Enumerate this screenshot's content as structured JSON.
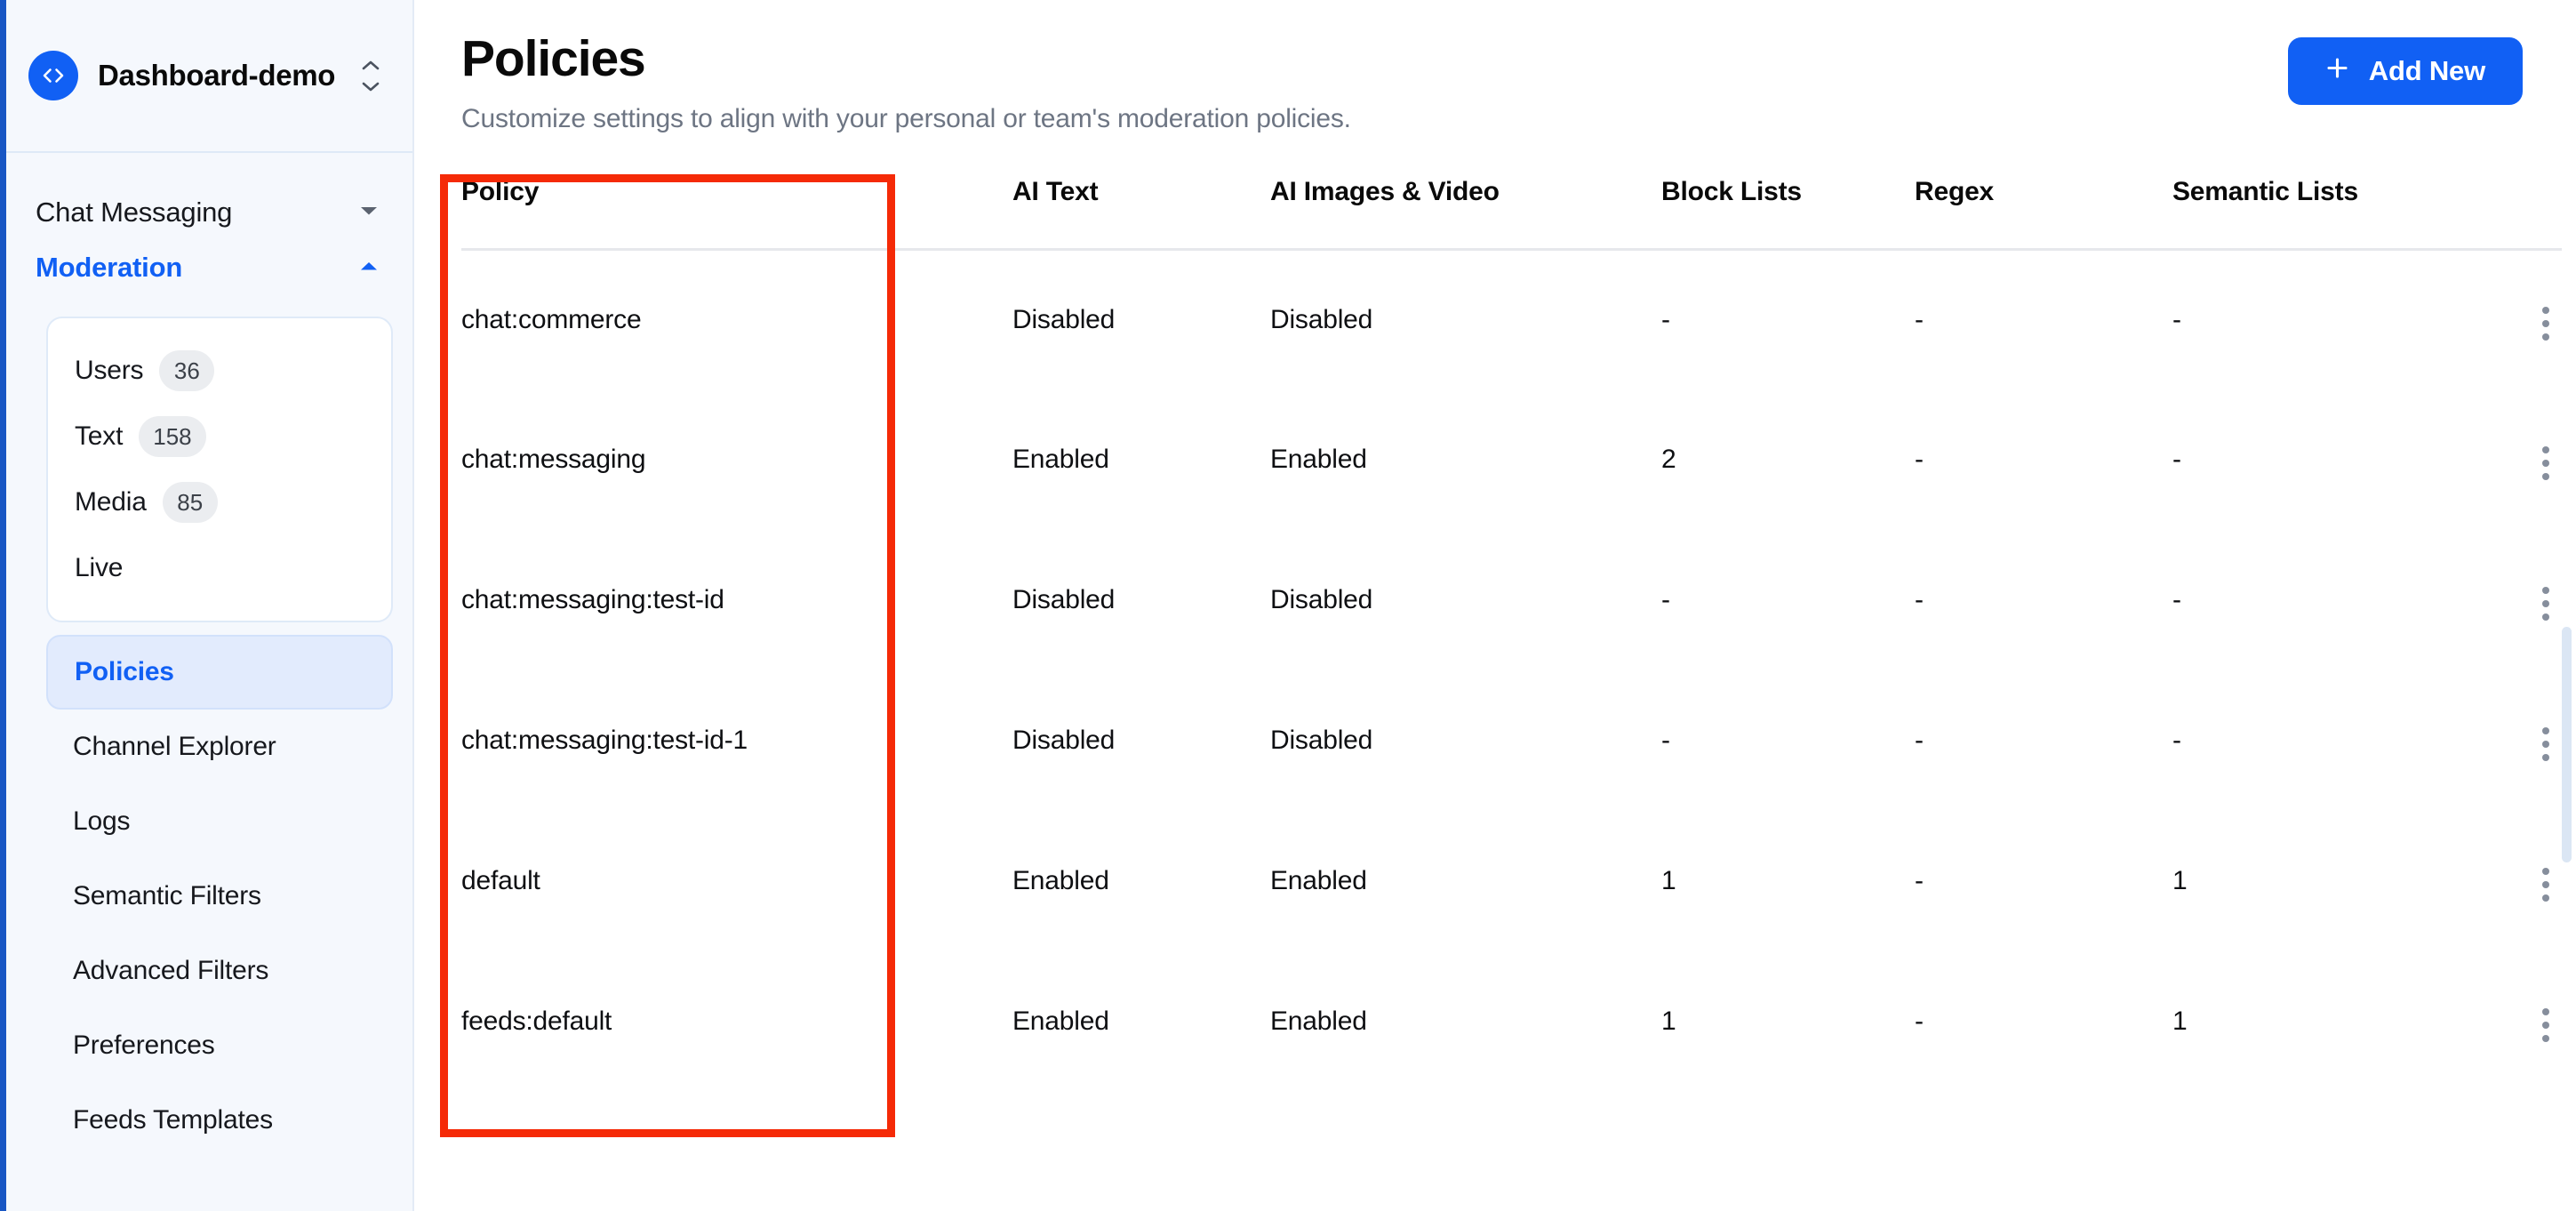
{
  "workspace": {
    "name": "Dashboard-demo",
    "logo_icon": "code-brackets-icon",
    "switcher_icon": "chevron-up-down-icon"
  },
  "sidebar": {
    "groups": [
      {
        "label": "Chat Messaging",
        "icon": "chevron-down-icon",
        "expanded": false
      },
      {
        "label": "Moderation",
        "icon": "chevron-up-icon",
        "expanded": true
      }
    ],
    "subnav": [
      {
        "label": "Users",
        "badge": "36"
      },
      {
        "label": "Text",
        "badge": "158"
      },
      {
        "label": "Media",
        "badge": "85"
      },
      {
        "label": "Live",
        "badge": ""
      }
    ],
    "menu": [
      {
        "label": "Policies",
        "active": true
      },
      {
        "label": "Channel Explorer",
        "active": false
      },
      {
        "label": "Logs",
        "active": false
      },
      {
        "label": "Semantic Filters",
        "active": false
      },
      {
        "label": "Advanced Filters",
        "active": false
      },
      {
        "label": "Preferences",
        "active": false
      },
      {
        "label": "Feeds Templates",
        "active": false
      }
    ]
  },
  "header": {
    "title": "Policies",
    "subtitle": "Customize settings to align with your personal or team's moderation policies.",
    "add_button": "Add New",
    "add_button_icon": "plus-icon"
  },
  "table": {
    "columns": [
      "Policy",
      "AI Text",
      "AI Images & Video",
      "Block Lists",
      "Regex",
      "Semantic Lists"
    ],
    "row_menu_icon": "kebab-menu-icon",
    "rows": [
      {
        "policy": "chat:commerce",
        "ai_text": "Disabled",
        "ai_images_video": "Disabled",
        "block_lists": "-",
        "regex": "-",
        "semantic_lists": "-"
      },
      {
        "policy": "chat:messaging",
        "ai_text": "Enabled",
        "ai_images_video": "Enabled",
        "block_lists": "2",
        "regex": "-",
        "semantic_lists": "-"
      },
      {
        "policy": "chat:messaging:test-id",
        "ai_text": "Disabled",
        "ai_images_video": "Disabled",
        "block_lists": "-",
        "regex": "-",
        "semantic_lists": "-"
      },
      {
        "policy": "chat:messaging:test-id-1",
        "ai_text": "Disabled",
        "ai_images_video": "Disabled",
        "block_lists": "-",
        "regex": "-",
        "semantic_lists": "-"
      },
      {
        "policy": "default",
        "ai_text": "Enabled",
        "ai_images_video": "Enabled",
        "block_lists": "1",
        "regex": "-",
        "semantic_lists": "1"
      },
      {
        "policy": "feeds:default",
        "ai_text": "Enabled",
        "ai_images_video": "Enabled",
        "block_lists": "1",
        "regex": "-",
        "semantic_lists": "1"
      }
    ]
  },
  "annotation": {
    "type": "highlight-rectangle",
    "color": "#f52a07",
    "target": "policy-column"
  },
  "colors": {
    "accent": "#1160f4",
    "sidebar_bg": "#f5f8fd",
    "active_item_bg": "#e2ebfd",
    "badge_bg": "#ebedf0",
    "annotation": "#f52a07"
  }
}
